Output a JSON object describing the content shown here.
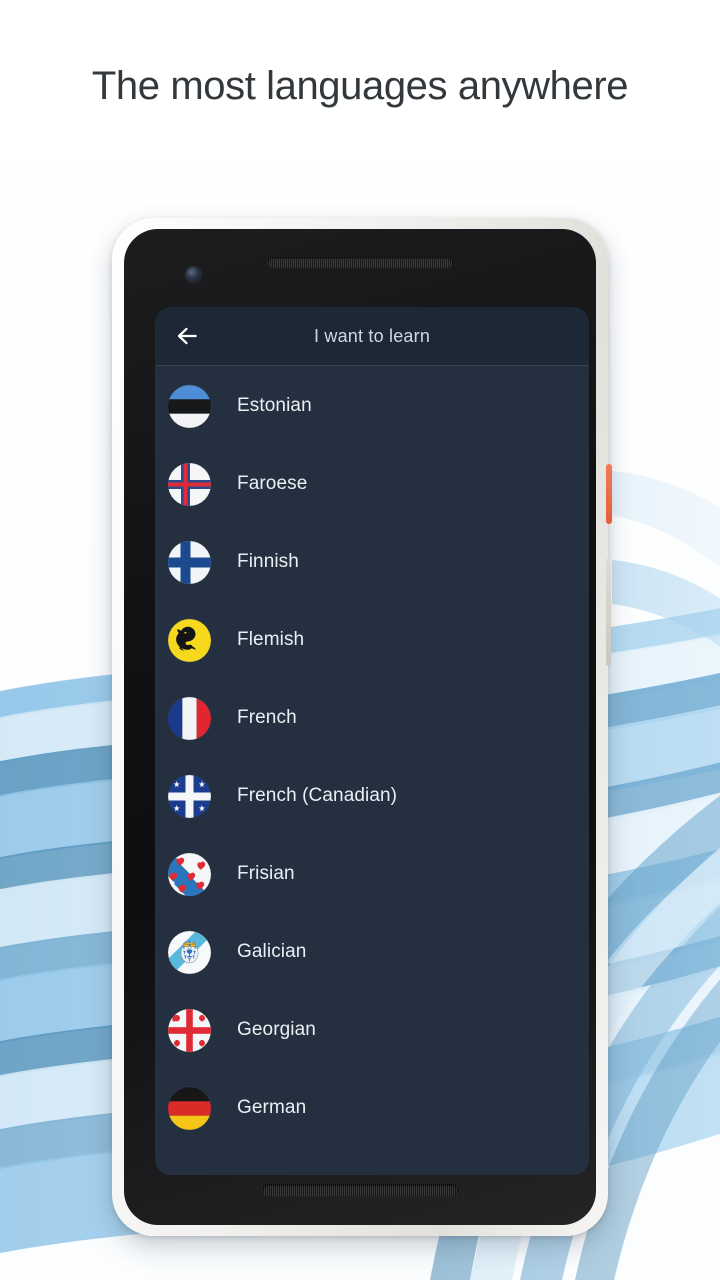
{
  "page": {
    "headline": "The most languages anywhere",
    "background_style": "blue-wave-bands",
    "colors": {
      "page_bg": "#fdfefe",
      "headline_text": "#33383d",
      "wave_light": "#cfe6f6",
      "wave_mid": "#8cc2e6",
      "wave_dark": "#4e8fb8",
      "screen_bg": "#24303f",
      "appbar_bg": "#1d2837",
      "appbar_divider": "#38434f",
      "appbar_title_text": "#ccd8e4",
      "list_text": "#eaeff4",
      "phone_bezel": "#f2f1ef",
      "phone_body": "#141416",
      "power_button": "#e2603a",
      "volume_button": "#dedcd7"
    }
  },
  "phone": {
    "hardware": {
      "front_camera": "front-camera",
      "top_speaker": "earpiece-speaker",
      "bottom_speaker": "loudspeaker",
      "power_button_label": "Power",
      "volume_button_label": "Volume"
    }
  },
  "appbar": {
    "back_icon": "arrow-left-icon",
    "title": "I want to learn"
  },
  "list": {
    "items": [
      {
        "name": "Estonian",
        "flag": "estonia-flag"
      },
      {
        "name": "Faroese",
        "flag": "faroe-islands-flag"
      },
      {
        "name": "Finnish",
        "flag": "finland-flag"
      },
      {
        "name": "Flemish",
        "flag": "flanders-flag"
      },
      {
        "name": "French",
        "flag": "france-flag"
      },
      {
        "name": "French (Canadian)",
        "flag": "quebec-flag"
      },
      {
        "name": "Frisian",
        "flag": "friesland-flag"
      },
      {
        "name": "Galician",
        "flag": "galicia-flag"
      },
      {
        "name": "Georgian",
        "flag": "georgia-flag"
      },
      {
        "name": "German",
        "flag": "germany-flag"
      }
    ]
  }
}
